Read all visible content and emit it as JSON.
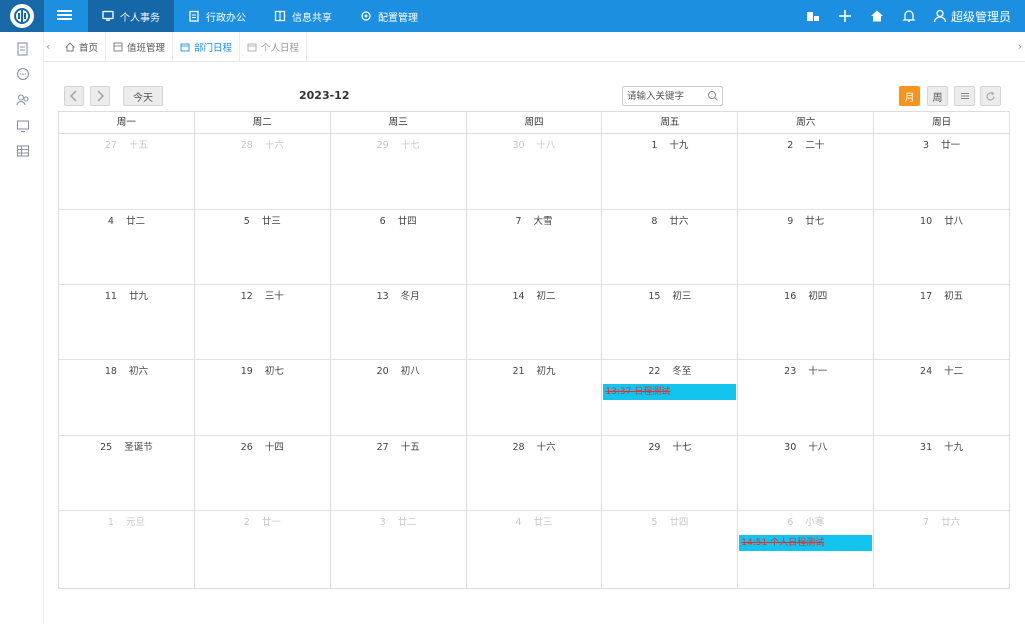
{
  "nav": {
    "items": [
      {
        "label": "个人事务",
        "active": true,
        "icon": "monitor-icon"
      },
      {
        "label": "行政办公",
        "active": false,
        "icon": "clipboard-icon"
      },
      {
        "label": "信息共享",
        "active": false,
        "icon": "book-icon"
      },
      {
        "label": "配置管理",
        "active": false,
        "icon": "gear-icon"
      }
    ],
    "user": "超级管理员"
  },
  "tabs": [
    {
      "label": "首页",
      "icon": "home-icon"
    },
    {
      "label": "值班管理",
      "icon": "grid-icon"
    },
    {
      "label": "部门日程",
      "icon": "calendar-icon"
    },
    {
      "label": "个人日程",
      "icon": "calendar-icon"
    }
  ],
  "toolbar": {
    "today": "今天",
    "title": "2023-12",
    "search_placeholder": "请输入关键字",
    "views": [
      "月",
      "周"
    ]
  },
  "weekdays": [
    "周一",
    "周二",
    "周三",
    "周四",
    "周五",
    "周六",
    "周日"
  ],
  "weeks": [
    [
      {
        "d": "27",
        "l": "十五",
        "o": true
      },
      {
        "d": "28",
        "l": "十六",
        "o": true
      },
      {
        "d": "29",
        "l": "十七",
        "o": true
      },
      {
        "d": "30",
        "l": "十八",
        "o": true
      },
      {
        "d": "1",
        "l": "十九"
      },
      {
        "d": "2",
        "l": "二十"
      },
      {
        "d": "3",
        "l": "廿一"
      }
    ],
    [
      {
        "d": "4",
        "l": "廿二"
      },
      {
        "d": "5",
        "l": "廿三"
      },
      {
        "d": "6",
        "l": "廿四"
      },
      {
        "d": "7",
        "l": "大雪"
      },
      {
        "d": "8",
        "l": "廿六"
      },
      {
        "d": "9",
        "l": "廿七"
      },
      {
        "d": "10",
        "l": "廿八"
      }
    ],
    [
      {
        "d": "11",
        "l": "廿九"
      },
      {
        "d": "12",
        "l": "三十"
      },
      {
        "d": "13",
        "l": "冬月"
      },
      {
        "d": "14",
        "l": "初二"
      },
      {
        "d": "15",
        "l": "初三"
      },
      {
        "d": "16",
        "l": "初四"
      },
      {
        "d": "17",
        "l": "初五"
      }
    ],
    [
      {
        "d": "18",
        "l": "初六"
      },
      {
        "d": "19",
        "l": "初七"
      },
      {
        "d": "20",
        "l": "初八"
      },
      {
        "d": "21",
        "l": "初九"
      },
      {
        "d": "22",
        "l": "冬至",
        "event": "13:37 日程测试"
      },
      {
        "d": "23",
        "l": "十一"
      },
      {
        "d": "24",
        "l": "十二"
      }
    ],
    [
      {
        "d": "25",
        "l": "圣诞节"
      },
      {
        "d": "26",
        "l": "十四"
      },
      {
        "d": "27",
        "l": "十五"
      },
      {
        "d": "28",
        "l": "十六"
      },
      {
        "d": "29",
        "l": "十七"
      },
      {
        "d": "30",
        "l": "十八"
      },
      {
        "d": "31",
        "l": "十九"
      }
    ],
    [
      {
        "d": "1",
        "l": "元旦",
        "o": true
      },
      {
        "d": "2",
        "l": "廿一",
        "o": true
      },
      {
        "d": "3",
        "l": "廿二",
        "o": true
      },
      {
        "d": "4",
        "l": "廿三",
        "o": true
      },
      {
        "d": "5",
        "l": "廿四",
        "o": true
      },
      {
        "d": "6",
        "l": "小寒",
        "o": true,
        "event": "14:51 个人日程测试"
      },
      {
        "d": "7",
        "l": "廿六",
        "o": true
      }
    ]
  ]
}
